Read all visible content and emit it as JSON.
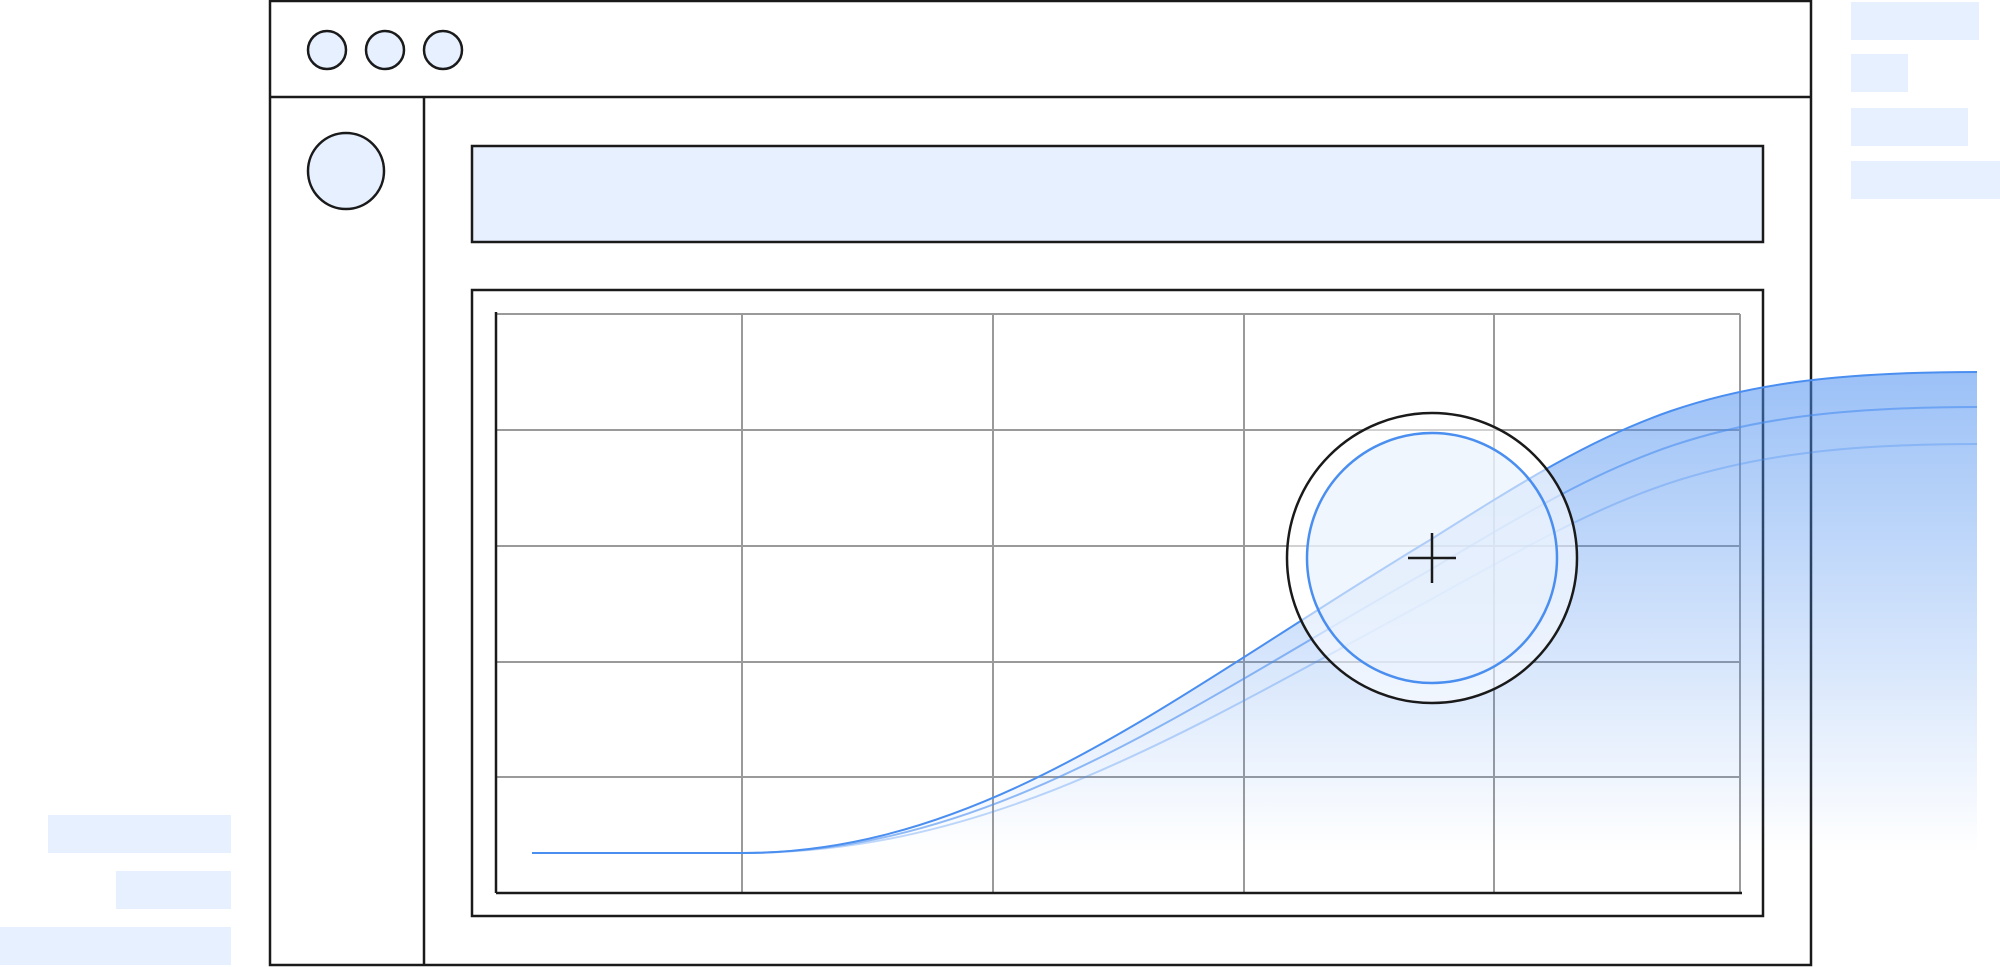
{
  "illustration": {
    "window_controls": [
      "close",
      "minimize",
      "maximize"
    ],
    "avatar_icon": "avatar-circle-icon",
    "magnifier_icon": "crosshair-magnifier-icon"
  },
  "colors": {
    "outline": "#1a1a1a",
    "grid": "#9a9a9a",
    "accent": "#4a8ef0",
    "placeholder_fill": "#e6f0fe",
    "area_fill_top": "#9cbff5"
  }
}
